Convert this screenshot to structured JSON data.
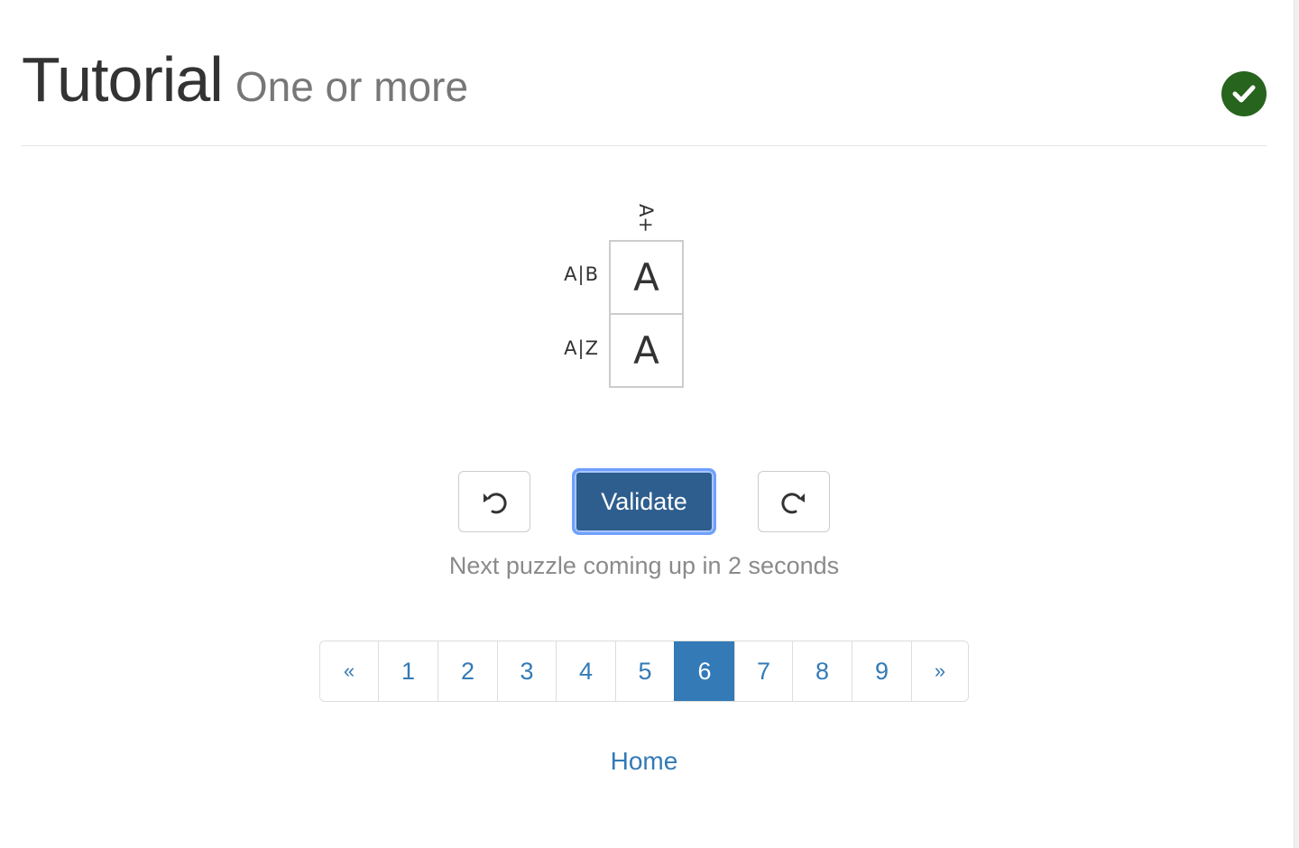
{
  "header": {
    "title": "Tutorial",
    "subtitle": "One or more",
    "status_icon": "check-circle-icon",
    "status_color": "#27641d"
  },
  "puzzle": {
    "column_headers": [
      "A+"
    ],
    "rows": [
      {
        "label": "A|B",
        "cells": [
          "A"
        ]
      },
      {
        "label": "A|Z",
        "cells": [
          "A"
        ]
      }
    ]
  },
  "controls": {
    "undo_icon": "undo-icon",
    "validate_label": "Validate",
    "redo_icon": "redo-icon",
    "validate_color": "#2e5e8e"
  },
  "status": {
    "message": "Next puzzle coming up in 2 seconds"
  },
  "pagination": {
    "prev_label": "«",
    "next_label": "»",
    "pages": [
      "1",
      "2",
      "3",
      "4",
      "5",
      "6",
      "7",
      "8",
      "9"
    ],
    "active_page": "6",
    "accent_color": "#337ab7"
  },
  "footer": {
    "home_label": "Home"
  }
}
